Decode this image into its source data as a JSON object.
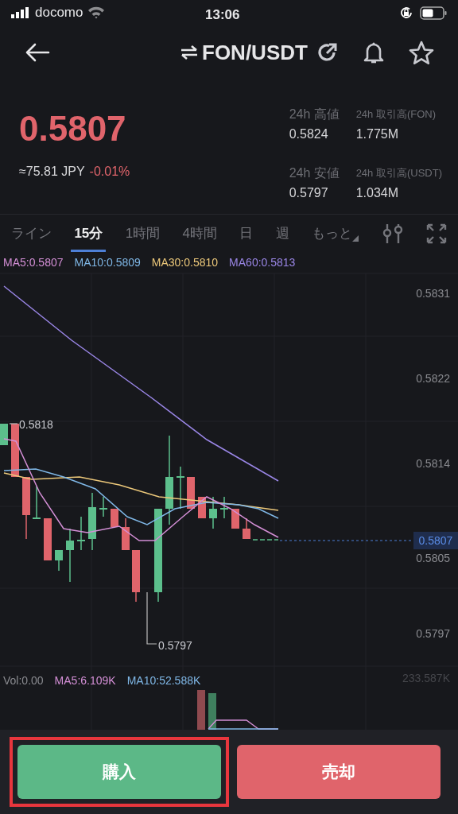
{
  "status_bar": {
    "carrier": "docomo",
    "time": "13:06"
  },
  "header": {
    "pair": "FON/USDT"
  },
  "price": {
    "last": "0.5807",
    "fiat": "≈75.81 JPY",
    "change": "-0.01%"
  },
  "stats": [
    {
      "label": "24h 高値",
      "value": "0.5824"
    },
    {
      "label": "24h 取引高(FON)",
      "value": "1.775M"
    },
    {
      "label": "24h 安値",
      "value": "0.5797"
    },
    {
      "label": "24h 取引高(USDT)",
      "value": "1.034M"
    }
  ],
  "intervals": [
    {
      "label": "ライン",
      "selected": false
    },
    {
      "label": "15分",
      "selected": true
    },
    {
      "label": "1時間",
      "selected": false
    },
    {
      "label": "4時間",
      "selected": false
    },
    {
      "label": "日",
      "selected": false
    },
    {
      "label": "週",
      "selected": false
    },
    {
      "label": "もっと",
      "selected": false
    }
  ],
  "ma_legend": [
    {
      "label": "MA5:0.5807",
      "color": "#d48fd6"
    },
    {
      "label": "MA10:0.5809",
      "color": "#7fb7e6"
    },
    {
      "label": "MA30:0.5810",
      "color": "#ecc87a"
    },
    {
      "label": "MA60:0.5813",
      "color": "#9a86e6"
    }
  ],
  "chart": {
    "y_labels": [
      "0.5831",
      "0.5822",
      "0.5814",
      "0.5805",
      "0.5797"
    ],
    "high_marker": "0.5818",
    "low_marker": "0.5797",
    "current_price": "0.5807"
  },
  "volume": {
    "legend": [
      {
        "label": "Vol:0.00",
        "color": "#8a8b90"
      },
      {
        "label": "MA5:6.109K",
        "color": "#d48fd6"
      },
      {
        "label": "MA10:52.588K",
        "color": "#7fb7e6"
      }
    ],
    "max_label": "233.587K"
  },
  "actions": [
    {
      "label": "購入",
      "kind": "buy",
      "highlighted": true
    },
    {
      "label": "売却",
      "kind": "sell",
      "highlighted": false
    }
  ]
}
